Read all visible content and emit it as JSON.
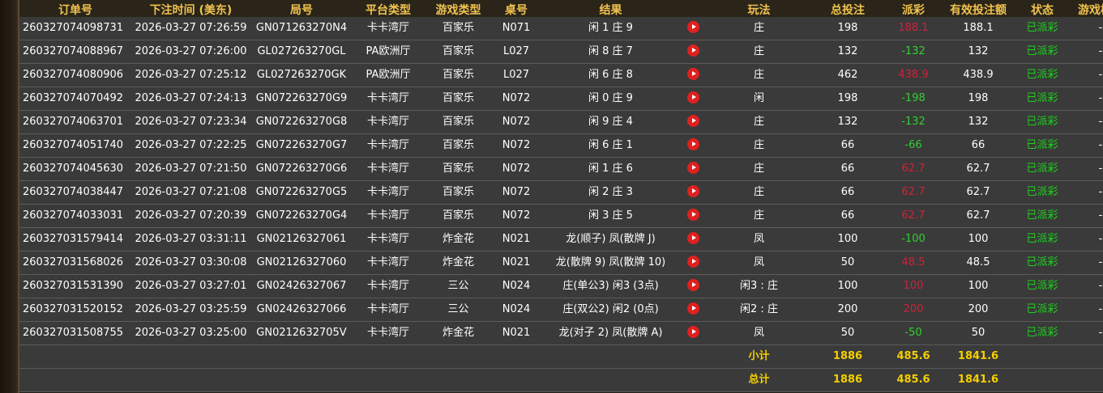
{
  "columns": [
    "订单号",
    "下注时间 (美东)",
    "局号",
    "平台类型",
    "游戏类型",
    "桌号",
    "结果",
    "",
    "玩法",
    "总投注",
    "派彩",
    "有效投注额",
    "状态",
    "游戏模式"
  ],
  "rows": [
    {
      "order": "260327074098731",
      "time": "2026-03-27 07:26:59",
      "round": "GN071263270N4",
      "platform": "卡卡湾厅",
      "game": "百家乐",
      "table": "N071",
      "result": "闲 1 庄 9",
      "play": "庄",
      "bet": "198",
      "payout": "188.1",
      "payout_type": "pos",
      "valid": "188.1",
      "status": "已派彩",
      "mode": "-"
    },
    {
      "order": "260327074088967",
      "time": "2026-03-27 07:26:00",
      "round": "GL027263270GL",
      "platform": "PA欧洲厅",
      "game": "百家乐",
      "table": "L027",
      "result": "闲 8 庄 7",
      "play": "庄",
      "bet": "132",
      "payout": "-132",
      "payout_type": "neg",
      "valid": "132",
      "status": "已派彩",
      "mode": "-"
    },
    {
      "order": "260327074080906",
      "time": "2026-03-27 07:25:12",
      "round": "GL027263270GK",
      "platform": "PA欧洲厅",
      "game": "百家乐",
      "table": "L027",
      "result": "闲 6 庄 8",
      "play": "庄",
      "bet": "462",
      "payout": "438.9",
      "payout_type": "pos",
      "valid": "438.9",
      "status": "已派彩",
      "mode": "-"
    },
    {
      "order": "260327074070492",
      "time": "2026-03-27 07:24:13",
      "round": "GN072263270G9",
      "platform": "卡卡湾厅",
      "game": "百家乐",
      "table": "N072",
      "result": "闲 0 庄 9",
      "play": "闲",
      "bet": "198",
      "payout": "-198",
      "payout_type": "neg",
      "valid": "198",
      "status": "已派彩",
      "mode": "-"
    },
    {
      "order": "260327074063701",
      "time": "2026-03-27 07:23:34",
      "round": "GN072263270G8",
      "platform": "卡卡湾厅",
      "game": "百家乐",
      "table": "N072",
      "result": "闲 9 庄 4",
      "play": "庄",
      "bet": "132",
      "payout": "-132",
      "payout_type": "neg",
      "valid": "132",
      "status": "已派彩",
      "mode": "-"
    },
    {
      "order": "260327074051740",
      "time": "2026-03-27 07:22:25",
      "round": "GN072263270G7",
      "platform": "卡卡湾厅",
      "game": "百家乐",
      "table": "N072",
      "result": "闲 6 庄 1",
      "play": "庄",
      "bet": "66",
      "payout": "-66",
      "payout_type": "neg",
      "valid": "66",
      "status": "已派彩",
      "mode": "-"
    },
    {
      "order": "260327074045630",
      "time": "2026-03-27 07:21:50",
      "round": "GN072263270G6",
      "platform": "卡卡湾厅",
      "game": "百家乐",
      "table": "N072",
      "result": "闲 1 庄 6",
      "play": "庄",
      "bet": "66",
      "payout": "62.7",
      "payout_type": "pos",
      "valid": "62.7",
      "status": "已派彩",
      "mode": "-"
    },
    {
      "order": "260327074038447",
      "time": "2026-03-27 07:21:08",
      "round": "GN072263270G5",
      "platform": "卡卡湾厅",
      "game": "百家乐",
      "table": "N072",
      "result": "闲 2 庄 3",
      "play": "庄",
      "bet": "66",
      "payout": "62.7",
      "payout_type": "pos",
      "valid": "62.7",
      "status": "已派彩",
      "mode": "-"
    },
    {
      "order": "260327074033031",
      "time": "2026-03-27 07:20:39",
      "round": "GN072263270G4",
      "platform": "卡卡湾厅",
      "game": "百家乐",
      "table": "N072",
      "result": "闲 3 庄 5",
      "play": "庄",
      "bet": "66",
      "payout": "62.7",
      "payout_type": "pos",
      "valid": "62.7",
      "status": "已派彩",
      "mode": "-"
    },
    {
      "order": "260327031579414",
      "time": "2026-03-27 03:31:11",
      "round": "GN02126327061",
      "platform": "卡卡湾厅",
      "game": "炸金花",
      "table": "N021",
      "result": "龙(顺子) 凤(散牌 J)",
      "play": "凤",
      "bet": "100",
      "payout": "-100",
      "payout_type": "neg",
      "valid": "100",
      "status": "已派彩",
      "mode": "-"
    },
    {
      "order": "260327031568026",
      "time": "2026-03-27 03:30:08",
      "round": "GN02126327060",
      "platform": "卡卡湾厅",
      "game": "炸金花",
      "table": "N021",
      "result": "龙(散牌 9) 凤(散牌 10)",
      "play": "凤",
      "bet": "50",
      "payout": "48.5",
      "payout_type": "pos",
      "valid": "48.5",
      "status": "已派彩",
      "mode": "-"
    },
    {
      "order": "260327031531390",
      "time": "2026-03-27 03:27:01",
      "round": "GN02426327067",
      "platform": "卡卡湾厅",
      "game": "三公",
      "table": "N024",
      "result": "庄(单公3) 闲3 (3点)",
      "play": "闲3 : 庄",
      "bet": "100",
      "payout": "100",
      "payout_type": "pos",
      "valid": "100",
      "status": "已派彩",
      "mode": "-"
    },
    {
      "order": "260327031520152",
      "time": "2026-03-27 03:25:59",
      "round": "GN02426327066",
      "platform": "卡卡湾厅",
      "game": "三公",
      "table": "N024",
      "result": "庄(双公2) 闲2 (0点)",
      "play": "闲2 : 庄",
      "bet": "200",
      "payout": "200",
      "payout_type": "pos",
      "valid": "200",
      "status": "已派彩",
      "mode": "-"
    },
    {
      "order": "260327031508755",
      "time": "2026-03-27 03:25:00",
      "round": "GN0212632705V",
      "platform": "卡卡湾厅",
      "game": "炸金花",
      "table": "N021",
      "result": "龙(对子 2) 凤(散牌 A)",
      "play": "凤",
      "bet": "50",
      "payout": "-50",
      "payout_type": "neg",
      "valid": "50",
      "status": "已派彩",
      "mode": "-"
    }
  ],
  "subtotal": {
    "label": "小计",
    "bet": "1886",
    "payout": "485.6",
    "valid": "1841.6"
  },
  "total": {
    "label": "总计",
    "bet": "1886",
    "payout": "485.6",
    "valid": "1841.6"
  },
  "icons": {
    "result_video": "play-video-icon"
  },
  "colors": {
    "header": "#f0c24e",
    "positive_payout": "#d3203a",
    "negative_payout": "#2fd12f",
    "status": "#1fd11f",
    "totals": "#f5d000"
  }
}
